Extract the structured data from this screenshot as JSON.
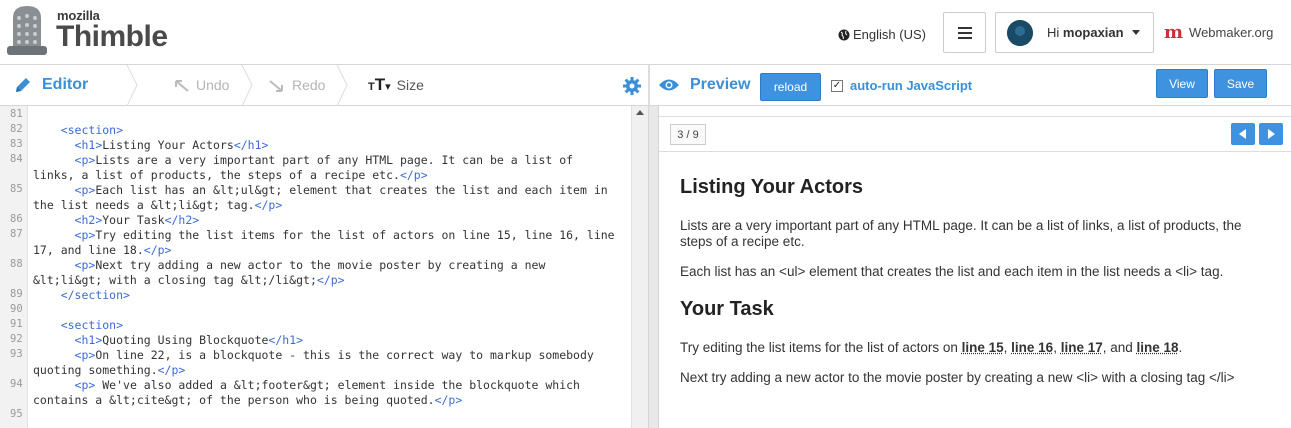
{
  "header": {
    "logo_top": "mozilla",
    "logo_main": "Thimble",
    "language": "English (US)",
    "greeting": "Hi",
    "username": "mopaxian",
    "webmaker_label": "Webmaker.org"
  },
  "toolbar": {
    "editor_label": "Editor",
    "undo_label": "Undo",
    "redo_label": "Redo",
    "size_label": "Size",
    "preview_label": "Preview",
    "reload_label": "reload",
    "autorun_label": "auto-run JavaScript",
    "autorun_checked": true,
    "view_label": "View",
    "save_label": "Save"
  },
  "editor": {
    "line_numbers": [
      "81",
      "82",
      "83",
      "84",
      "",
      "85",
      "",
      "86",
      "87",
      "",
      "88",
      "",
      "89",
      "90",
      "91",
      "92",
      "93",
      "",
      "94",
      "",
      "95"
    ],
    "lines": [
      {
        "indent": "",
        "parts": [
          {
            "t": "tag",
            "v": ""
          }
        ]
      },
      {
        "indent": "    ",
        "parts": [
          {
            "t": "tag",
            "v": "<section>"
          }
        ]
      },
      {
        "indent": "      ",
        "parts": [
          {
            "t": "tag",
            "v": "<h1>"
          },
          {
            "t": "txt",
            "v": "Listing Your Actors"
          },
          {
            "t": "tag",
            "v": "</h1>"
          }
        ]
      },
      {
        "indent": "      ",
        "parts": [
          {
            "t": "tag",
            "v": "<p>"
          },
          {
            "t": "txt",
            "v": "Lists are a very important part of any HTML page. It can be a list of"
          }
        ]
      },
      {
        "indent": "",
        "parts": [
          {
            "t": "txt",
            "v": "links, a list of products, the steps of a recipe etc."
          },
          {
            "t": "tag",
            "v": "</p>"
          }
        ]
      },
      {
        "indent": "      ",
        "parts": [
          {
            "t": "tag",
            "v": "<p>"
          },
          {
            "t": "txt",
            "v": "Each list has an &lt;ul&gt; element that creates the list and each item in"
          }
        ]
      },
      {
        "indent": "",
        "parts": [
          {
            "t": "txt",
            "v": "the list needs a &lt;li&gt; tag."
          },
          {
            "t": "tag",
            "v": "</p>"
          }
        ]
      },
      {
        "indent": "      ",
        "parts": [
          {
            "t": "tag",
            "v": "<h2>"
          },
          {
            "t": "txt",
            "v": "Your Task"
          },
          {
            "t": "tag",
            "v": "</h2>"
          }
        ]
      },
      {
        "indent": "      ",
        "parts": [
          {
            "t": "tag",
            "v": "<p>"
          },
          {
            "t": "txt",
            "v": "Try editing the list items for the list of actors on line 15, line 16, line"
          }
        ]
      },
      {
        "indent": "",
        "parts": [
          {
            "t": "txt",
            "v": "17, and line 18."
          },
          {
            "t": "tag",
            "v": "</p>"
          }
        ]
      },
      {
        "indent": "      ",
        "parts": [
          {
            "t": "tag",
            "v": "<p>"
          },
          {
            "t": "txt",
            "v": "Next try adding a new actor to the movie poster by creating a new"
          }
        ]
      },
      {
        "indent": "",
        "parts": [
          {
            "t": "txt",
            "v": "&lt;li&gt; with a closing tag &lt;/li&gt;"
          },
          {
            "t": "tag",
            "v": "</p>"
          }
        ]
      },
      {
        "indent": "    ",
        "parts": [
          {
            "t": "tag",
            "v": "</section>"
          }
        ]
      },
      {
        "indent": "",
        "parts": [
          {
            "t": "txt",
            "v": ""
          }
        ]
      },
      {
        "indent": "    ",
        "parts": [
          {
            "t": "tag",
            "v": "<section>"
          }
        ]
      },
      {
        "indent": "      ",
        "parts": [
          {
            "t": "tag",
            "v": "<h1>"
          },
          {
            "t": "txt",
            "v": "Quoting Using Blockquote"
          },
          {
            "t": "tag",
            "v": "</h1>"
          }
        ]
      },
      {
        "indent": "      ",
        "parts": [
          {
            "t": "tag",
            "v": "<p>"
          },
          {
            "t": "txt",
            "v": "On line 22, is a blockquote - this is the correct way to markup somebody"
          }
        ]
      },
      {
        "indent": "",
        "parts": [
          {
            "t": "txt",
            "v": "quoting something."
          },
          {
            "t": "tag",
            "v": "</p>"
          }
        ]
      },
      {
        "indent": "      ",
        "parts": [
          {
            "t": "tag",
            "v": "<p>"
          },
          {
            "t": "txt",
            "v": " We've also added a &lt;footer&gt; element inside the blockquote which"
          }
        ]
      },
      {
        "indent": "",
        "parts": [
          {
            "t": "txt",
            "v": "contains a &lt;cite&gt; of the person who is being quoted."
          },
          {
            "t": "tag",
            "v": "</p>"
          }
        ]
      },
      {
        "indent": "",
        "parts": [
          {
            "t": "txt",
            "v": ""
          }
        ]
      }
    ]
  },
  "preview": {
    "page_count": "3 / 9",
    "h1": "Listing Your Actors",
    "p1": "Lists are a very important part of any HTML page. It can be a list of links, a list of products, the steps of a recipe etc.",
    "p2": "Each list has an <ul> element that creates the list and each item in the list needs a <li> tag.",
    "h2": "Your Task",
    "p3_prefix": "Try editing the list items for the list of actors on ",
    "p3_line15": "line 15",
    "p3_line16": "line 16",
    "p3_line17": "line 17",
    "p3_and": ", and ",
    "p3_line18": "line 18",
    "p3_end": ".",
    "p3_comma": ", ",
    "p4": "Next try adding a new actor to the movie poster by creating a new <li> with a closing tag </li>"
  }
}
